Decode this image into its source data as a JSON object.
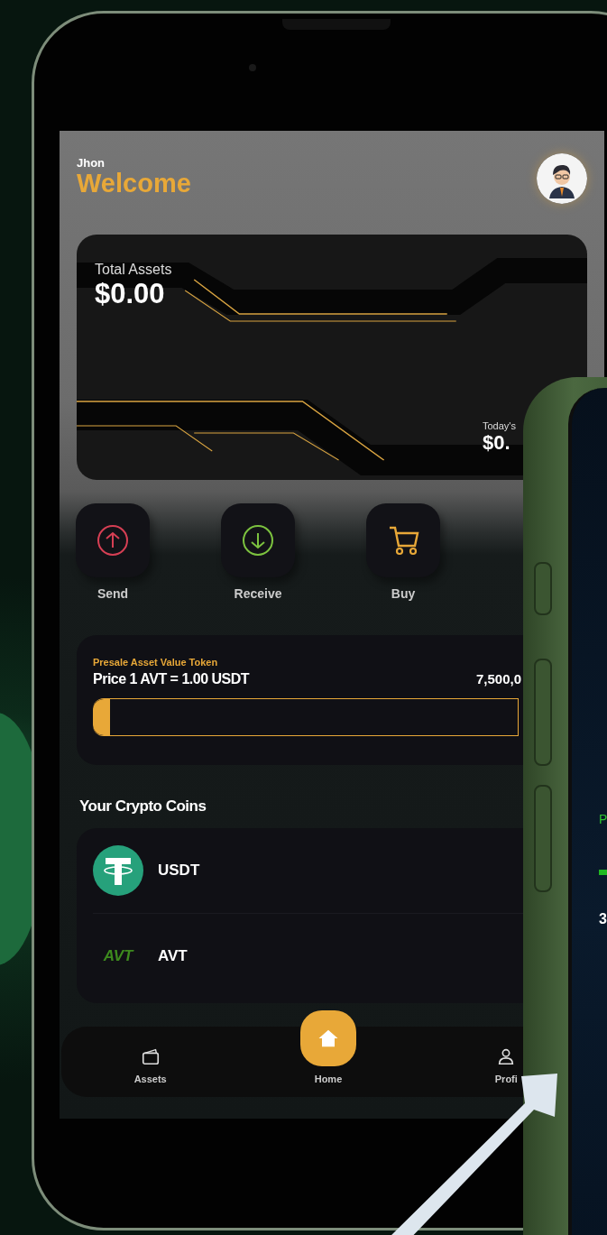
{
  "header": {
    "username": "Jhon",
    "greeting": "Welcome"
  },
  "asset_card": {
    "label": "Total Assets",
    "value": "$0.00",
    "today_label": "Today's",
    "today_value": "$0."
  },
  "actions": [
    {
      "label": "Send",
      "kind": "send"
    },
    {
      "label": "Receive",
      "kind": "receive"
    },
    {
      "label": "Buy",
      "kind": "buy"
    }
  ],
  "presale": {
    "title": "Presale Asset Value Token",
    "price": "Price 1 AVT = 1.00 USDT",
    "amount": "7,500,0",
    "level": 0.04
  },
  "coins_title": "Your Crypto Coins",
  "coins": [
    {
      "symbol": "USDT",
      "kind": "usdt"
    },
    {
      "symbol": "AVT",
      "kind": "avt",
      "logo": "AVT"
    }
  ],
  "nav": [
    {
      "label": "Assets",
      "kind": "wallet",
      "selected": false
    },
    {
      "label": "Home",
      "kind": "home",
      "selected": true
    },
    {
      "label": "Profi",
      "kind": "profile",
      "selected": false
    }
  ],
  "second_phone": {
    "heading": "P",
    "figure": "3"
  }
}
